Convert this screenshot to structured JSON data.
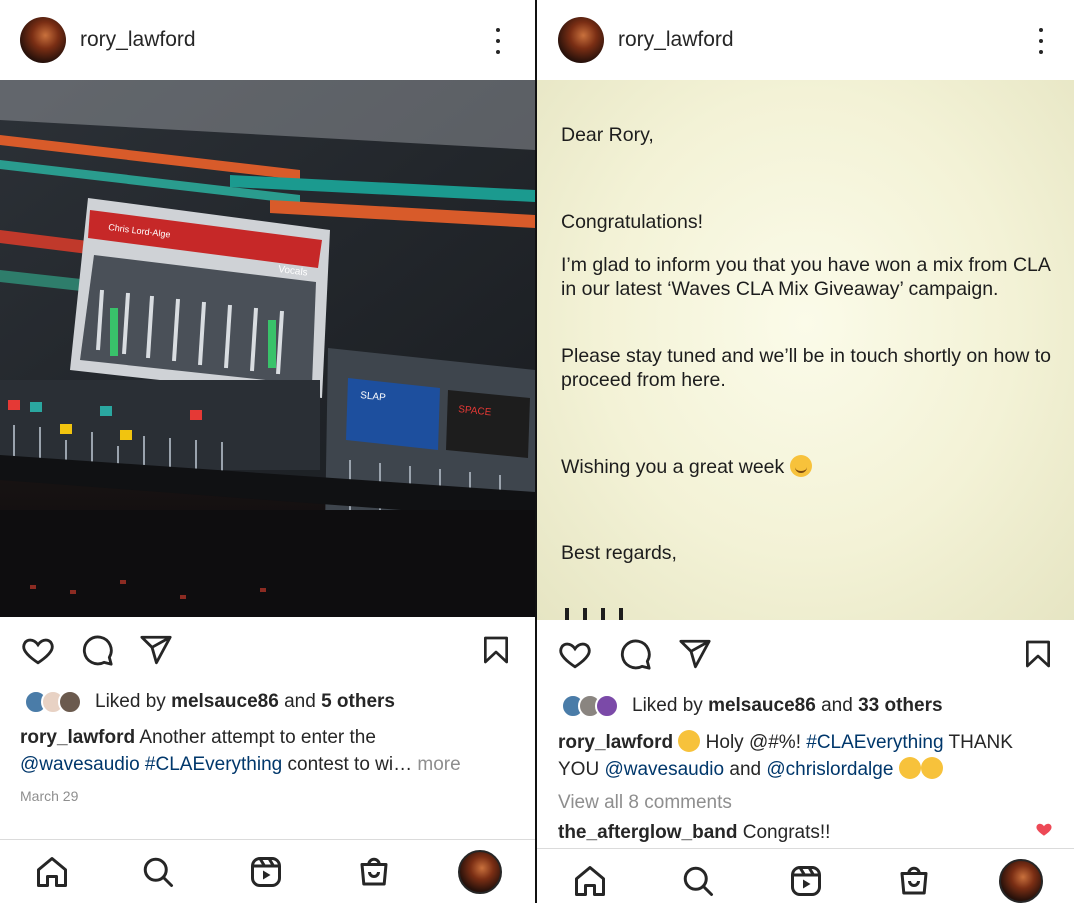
{
  "left_post": {
    "username": "rory_lawford",
    "liked_by_prefix": "Liked by",
    "liked_by_user": "melsauce86",
    "liked_by_and": "and",
    "liked_by_others": "5 others",
    "caption_user": "rory_lawford",
    "caption_text_1": "Another attempt to enter the",
    "caption_mention": "@wavesaudio",
    "caption_hashtag": "#CLAEverything",
    "caption_text_2": "contest to wi…",
    "more_label": "more",
    "date": "March 29",
    "photo_plugin_label": "Chris Lord-Alge",
    "photo_brand_label": "Vocals",
    "photo_slap_label": "SLAP",
    "photo_space_label": "SPACE"
  },
  "right_post": {
    "username": "rory_lawford",
    "letter": {
      "greeting": "Dear Rory,",
      "congrats": "Congratulations!",
      "body_1": "I’m glad to inform you that you have won a mix from CLA in our latest ‘Waves CLA Mix Giveaway’ campaign.",
      "body_2": "Please stay tuned and we’ll be in touch shortly on how to proceed from here.",
      "wish": "Wishing you a great week",
      "closing": "Best regards,"
    },
    "liked_by_prefix": "Liked by",
    "liked_by_user": "melsauce86",
    "liked_by_and": "and",
    "liked_by_others": "33 others",
    "caption_user": "rory_lawford",
    "caption_text_1": "Holy @#%!",
    "caption_hashtag": "#CLAEverything",
    "caption_text_2": "THANK YOU",
    "caption_mention_1": "@wavesaudio",
    "caption_and": "and",
    "caption_mention_2": "@chrislordalge",
    "view_comments": "View all 8 comments",
    "comment_user": "the_afterglow_band",
    "comment_text": "Congrats!!"
  },
  "icons": {
    "like": "heart-icon",
    "comment": "comment-icon",
    "share": "send-icon",
    "save": "bookmark-icon",
    "home": "home-icon",
    "search": "search-icon",
    "reels": "reels-icon",
    "shop": "shop-icon",
    "more": "more-options-icon",
    "liked_comment": "filled-heart-icon"
  },
  "colors": {
    "text": "#262626",
    "link": "#00376b",
    "muted": "#8e8e8e",
    "heart_red": "#ed4956"
  }
}
